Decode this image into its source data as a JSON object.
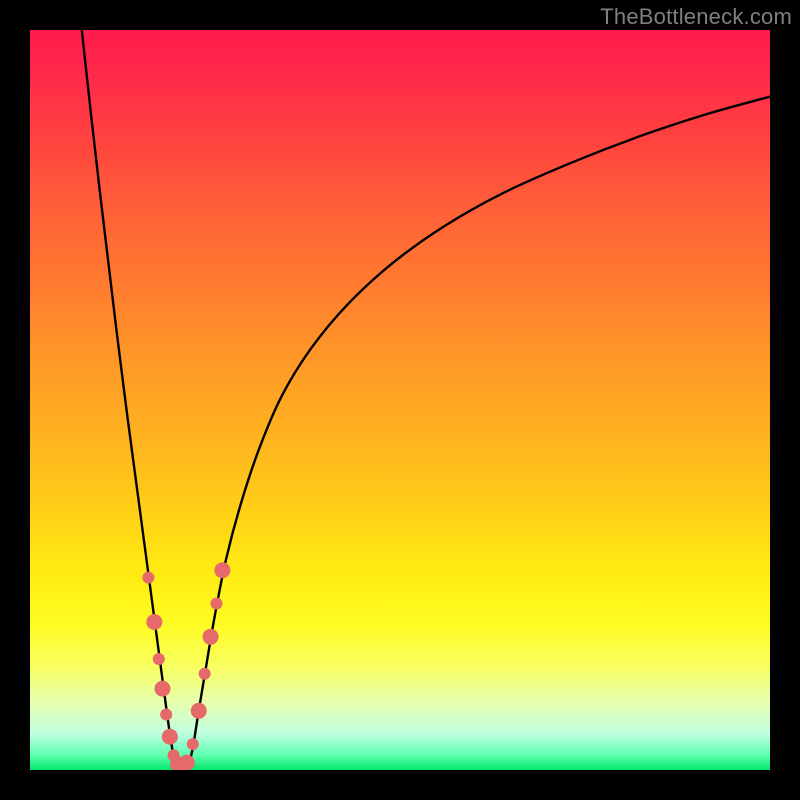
{
  "watermark": {
    "text": "TheBottleneck.com"
  },
  "chart_data": {
    "type": "line",
    "title": "",
    "xlabel": "",
    "ylabel": "",
    "xlim": [
      0,
      100
    ],
    "ylim": [
      0,
      100
    ],
    "gradient_note": "Background gradient top→bottom red → orange → yellow → green representing bottleneck %",
    "series": [
      {
        "name": "left-branch",
        "x": [
          7.0,
          8.2,
          9.4,
          10.6,
          11.8,
          13.0,
          14.2,
          15.4,
          16.2,
          17.0,
          17.8,
          18.6,
          19.2,
          19.6
        ],
        "y": [
          100,
          89,
          78.5,
          68.5,
          58.5,
          49.0,
          40.0,
          31.0,
          25.0,
          19.0,
          13.0,
          7.0,
          3.0,
          0.5
        ]
      },
      {
        "name": "right-branch",
        "x": [
          21.4,
          22.0,
          22.8,
          23.8,
          25.0,
          26.5,
          28.5,
          31.0,
          34.0,
          38.0,
          43.0,
          49.0,
          56.0,
          64.0,
          73.0,
          82.0,
          91.0,
          100.0
        ],
        "y": [
          0.5,
          3.0,
          8.0,
          14.0,
          21.0,
          28.5,
          36.0,
          43.5,
          50.5,
          57.0,
          63.0,
          68.5,
          73.5,
          78.0,
          82.0,
          85.5,
          88.5,
          91.0
        ]
      }
    ],
    "highlight_points": {
      "name": "markers",
      "color": "#e66a6a",
      "points": [
        {
          "x": 16.0,
          "y": 26.0,
          "r": 6
        },
        {
          "x": 16.8,
          "y": 20.0,
          "r": 8
        },
        {
          "x": 17.4,
          "y": 15.0,
          "r": 6
        },
        {
          "x": 17.9,
          "y": 11.0,
          "r": 8
        },
        {
          "x": 18.4,
          "y": 7.5,
          "r": 6
        },
        {
          "x": 18.9,
          "y": 4.5,
          "r": 8
        },
        {
          "x": 19.4,
          "y": 2.0,
          "r": 6
        },
        {
          "x": 20.0,
          "y": 0.8,
          "r": 8
        },
        {
          "x": 20.6,
          "y": 0.6,
          "r": 6
        },
        {
          "x": 21.2,
          "y": 1.0,
          "r": 8
        },
        {
          "x": 22.0,
          "y": 3.5,
          "r": 6
        },
        {
          "x": 22.8,
          "y": 8.0,
          "r": 8
        },
        {
          "x": 23.6,
          "y": 13.0,
          "r": 6
        },
        {
          "x": 24.4,
          "y": 18.0,
          "r": 8
        },
        {
          "x": 25.2,
          "y": 22.5,
          "r": 6
        },
        {
          "x": 26.0,
          "y": 27.0,
          "r": 8
        }
      ]
    }
  }
}
